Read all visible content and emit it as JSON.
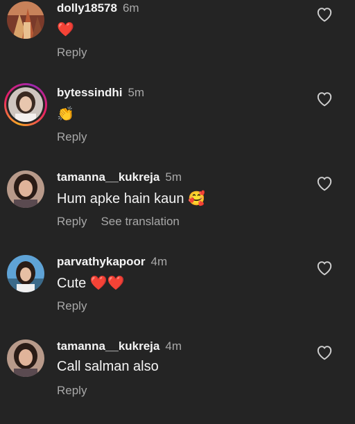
{
  "comments": [
    {
      "username": "dolly18578",
      "time": "6m",
      "text": "❤️",
      "reply": "Reply",
      "avatar_icon": "temple-photo",
      "has_story_ring": false
    },
    {
      "username": "bytessindhi",
      "time": "5m",
      "text": "👏",
      "reply": "Reply",
      "avatar_icon": "woman-photo",
      "has_story_ring": true
    },
    {
      "username": "tamanna__kukreja",
      "time": "5m",
      "text": "Hum apke hain kaun 🥰",
      "reply": "Reply",
      "see_translation": "See translation",
      "avatar_icon": "woman-photo",
      "has_story_ring": false
    },
    {
      "username": "parvathykapoor",
      "time": "4m",
      "text": "Cute ❤️❤️",
      "reply": "Reply",
      "avatar_icon": "woman-photo-sky",
      "has_story_ring": false
    },
    {
      "username": "tamanna__kukreja",
      "time": "4m",
      "text": "Call salman also",
      "reply": "Reply",
      "avatar_icon": "woman-photo",
      "has_story_ring": false
    }
  ],
  "colors": {
    "background": "#242424",
    "primary_text": "#f4f4f4",
    "secondary_text": "#a8a8a8",
    "heart_outline": "#cfcfcf"
  }
}
